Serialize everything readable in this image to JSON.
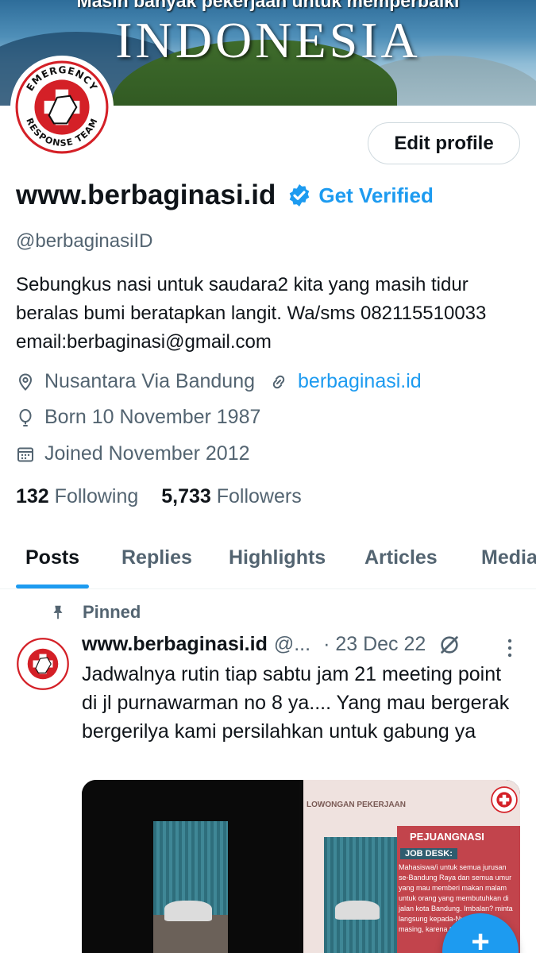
{
  "banner": {
    "subtitle": "Masih banyak pekerjaan untuk memperbaiki",
    "title": "INDONESIA"
  },
  "avatar": {
    "logo_top_text": "EMERGENCY",
    "logo_bottom_text": "RESPONSE TEAM"
  },
  "profile": {
    "edit_label": "Edit profile",
    "display_name": "www.berbaginasi.id",
    "get_verified": "Get Verified",
    "handle": "@berbaginasiID",
    "bio": "Sebungkus nasi untuk saudara2 kita yang masih tidur beralas bumi beratapkan langit. Wa/sms 082115510033 email:berbaginasi@gmail.com",
    "location": "Nusantara Via Bandung",
    "website": "berbaginasi.id",
    "born": "Born 10 November 1987",
    "joined": "Joined November 2012",
    "following_count": "132",
    "following_label": "Following",
    "followers_count": "5,733",
    "followers_label": "Followers"
  },
  "tabs": [
    {
      "label": "Posts",
      "active": true
    },
    {
      "label": "Replies"
    },
    {
      "label": "Highlights"
    },
    {
      "label": "Articles"
    },
    {
      "label": "Media"
    }
  ],
  "post": {
    "pinned_label": "Pinned",
    "author_name": "www.berbaginasi.id",
    "author_handle": "@...",
    "date": "· 23 Dec 22",
    "text": "Jadwalnya rutin tiap sabtu jam 21 meeting point di jl purnawarman no 8 ya.... Yang mau bergerak bergerilya kami persilahkan untuk gabung ya",
    "media2": {
      "header": "LOWONGAN PEKERJAAN",
      "title": "PEJUANGNASI",
      "job_desk": "JOB DESK:",
      "desc": "Mahasiswa/i untuk semua jurusan se-Bandung Raya dan semua umur yang mau memberi makan malam untuk orang yang membutuhkan di jalan kota Bandung. Imbalan? minta langsung kepada-Nya masing-masing, karena tidak ada balasan"
    }
  },
  "fab": {
    "label": "+"
  },
  "colors": {
    "accent": "#1d9bf0",
    "text": "#0f1419",
    "muted": "#536471"
  }
}
